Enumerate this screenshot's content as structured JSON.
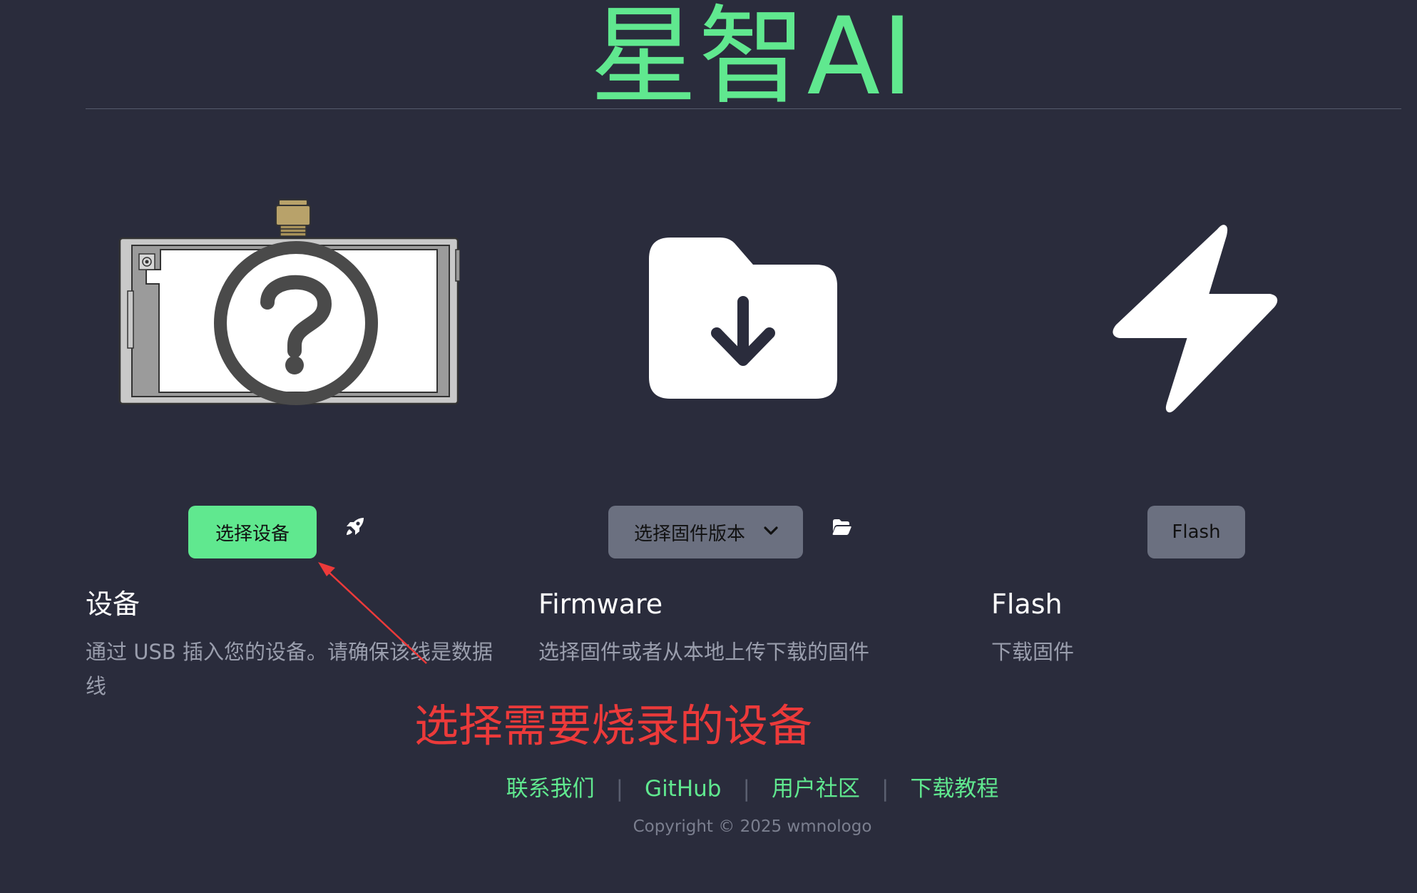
{
  "header": {
    "title": "星智AI"
  },
  "steps": [
    {
      "button_label": "选择设备",
      "extra_icon": "rocket-icon",
      "heading": "设备",
      "description": "通过 USB 插入您的设备。请确保该线是数据线",
      "illustration": "device-question-icon"
    },
    {
      "button_label": "选择固件版本",
      "extra_icon": "folder-open-icon",
      "heading": "Firmware",
      "description": "选择固件或者从本地上传下载的固件",
      "illustration": "folder-download-icon"
    },
    {
      "button_label": "Flash",
      "heading": "Flash",
      "description": "下载固件",
      "illustration": "lightning-icon"
    }
  ],
  "annotation": {
    "text": "选择需要烧录的设备"
  },
  "footer": {
    "links": [
      "联系我们",
      "GitHub",
      "用户社区",
      "下载教程"
    ],
    "separator": "|",
    "copyright": "Copyright © 2025 wmnologo"
  },
  "colors": {
    "background": "#2a2c3c",
    "accent": "#60e88f",
    "muted_button": "#6b7080",
    "annotation": "#ec3a3a"
  }
}
